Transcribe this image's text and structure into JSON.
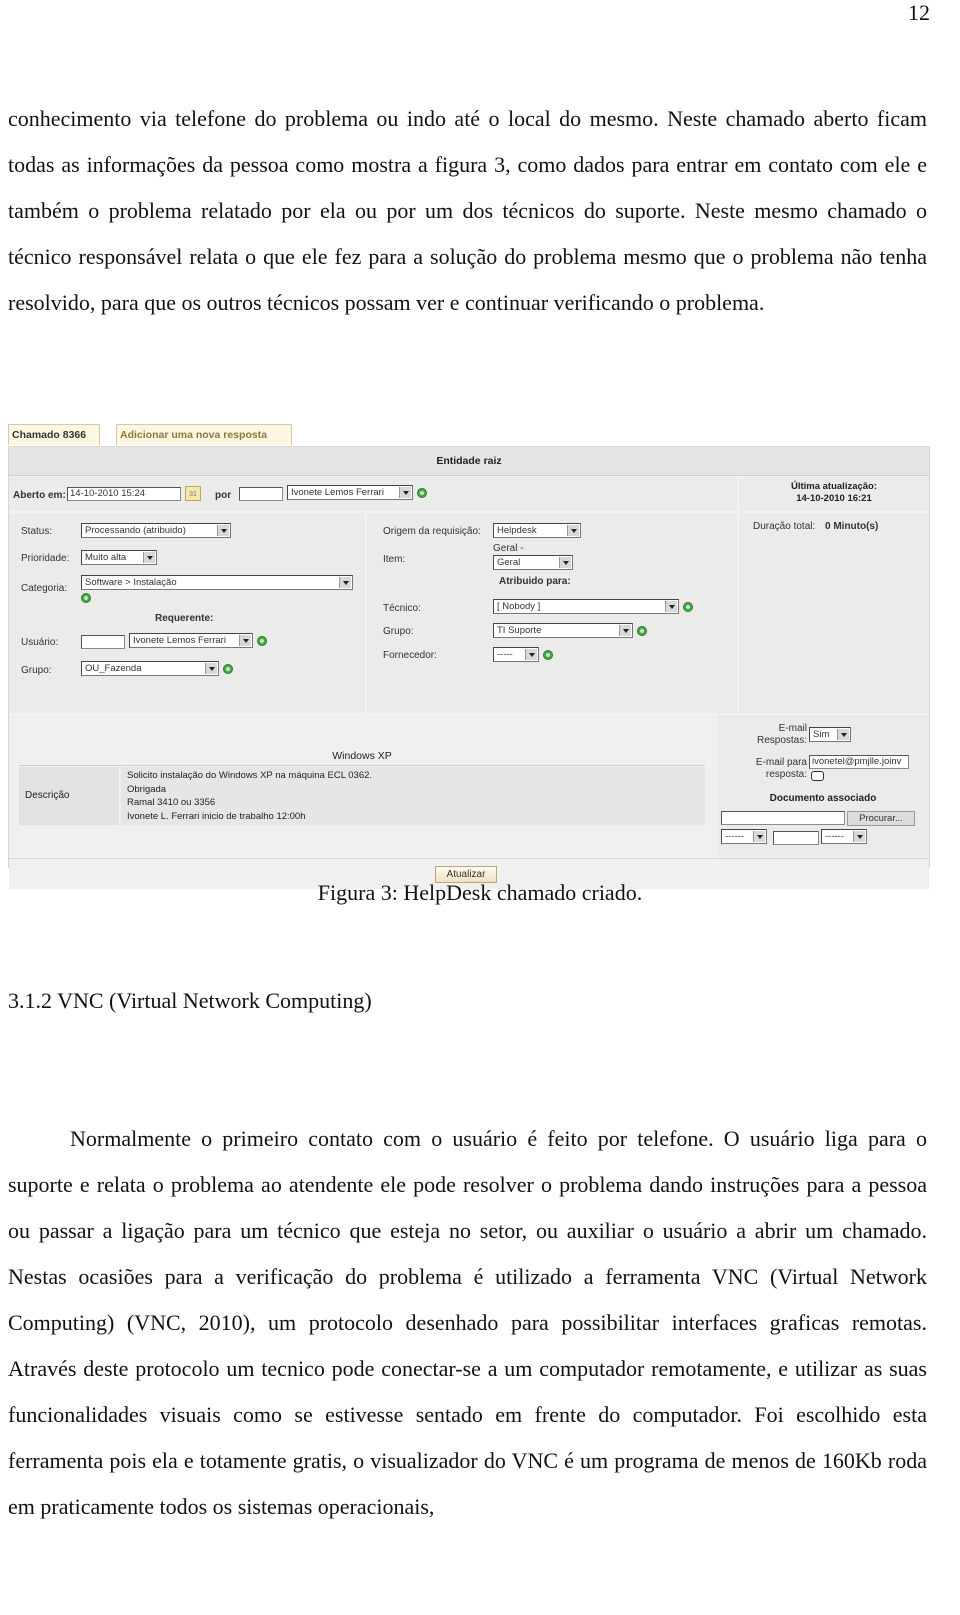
{
  "page_number": "12",
  "paragraph1": "conhecimento via telefone do problema ou indo até o local do mesmo. Neste chamado aberto ficam todas as informações da pessoa como mostra a figura 3, como dados para entrar em contato com ele e também o problema relatado por ela ou por um dos técnicos do suporte. Neste mesmo chamado o técnico responsável relata o que ele fez para a solução do problema mesmo que o problema não tenha resolvido, para que os outros técnicos possam ver e continuar verificando o problema.",
  "figure": {
    "tabs": [
      "Chamado 8366",
      "Adicionar uma nova resposta"
    ],
    "entity": "Entidade raiz",
    "opened": {
      "label": "Aberto em:",
      "date": "14-10-2010 15:24",
      "calendar_icon": "31",
      "by_label": "por",
      "by_input": "",
      "by_user": "Ivonete Lemos Ferrari"
    },
    "last_update": {
      "label": "Última atualização:",
      "value": "14-10-2010 16:21"
    },
    "left": {
      "status_label": "Status:",
      "status_value": "Processando (atribuido)",
      "priority_label": "Prioridade:",
      "priority_value": "Muito alta",
      "category_label": "Categoria:",
      "category_value": "Software > Instalação",
      "requester_title": "Requerente:",
      "user_label": "Usuário:",
      "user_input": "",
      "user_value": "Ivonete Lemos Ferrari",
      "group_label": "Grupo:",
      "group_value": "OU_Fazenda"
    },
    "middle": {
      "origin_label": "Origem da requisição:",
      "origin_value": "Helpdesk",
      "item_label": "Item:",
      "item_caption": "Geral -",
      "item_value": "Geral",
      "assigned_title": "Atribuido para:",
      "tech_label": "Técnico:",
      "tech_value": "[ Nobody ]",
      "group_label": "Grupo:",
      "group_value": "TI Suporte",
      "supplier_label": "Fornecedor:",
      "supplier_value": "-----"
    },
    "right": {
      "duration_label": "Duração total:",
      "duration_value": "0 Minuto(s)"
    },
    "description": {
      "title": "Windows XP",
      "label": "Descrição",
      "lines": [
        "Solicito instalação do Windows XP na máquina ECL 0362.",
        "Obrigada",
        "Ramal 3410 ou 3356",
        "Ivonete L. Ferrari inicio de trabalho 12:00h"
      ]
    },
    "side": {
      "email_replies_label1": "E-mail",
      "email_replies_label2": "Respostas:",
      "email_replies_value": "Sim",
      "email_to_label1": "E-mail para",
      "email_to_label2": "resposta:",
      "email_to_value": "ivonetel@pmjlle.joinv",
      "doc_title": "Documento associado",
      "doc_file_input": "",
      "browse_button": "Procurar...",
      "doc_select1": "------",
      "doc_input": "",
      "doc_select2": "------"
    },
    "update_button": "Atualizar"
  },
  "caption": "Figura 3: HelpDesk chamado criado.",
  "heading": "3.1.2 VNC (Virtual Network Computing)",
  "paragraph2": "Normalmente o primeiro contato com o usuário é feito por telefone. O usuário liga para o suporte e relata o problema ao atendente ele pode resolver o problema dando instruções para a pessoa ou passar a ligação para um técnico que esteja no setor, ou auxiliar o usuário a abrir um chamado. Nestas ocasiões para a verificação do problema é utilizado a ferramenta VNC (Virtual Network Computing) (VNC, 2010), um protocolo desenhado para possibilitar interfaces graficas remotas. Através deste protocolo um tecnico pode conectar-se a um computador remotamente, e utilizar as suas funcionalidades visuais como se estivesse sentado em frente do computador. Foi escolhido esta ferramenta pois ela e totamente gratis, o visualizador do VNC é um programa de menos de 160Kb roda em praticamente todos os sistemas operacionais,"
}
